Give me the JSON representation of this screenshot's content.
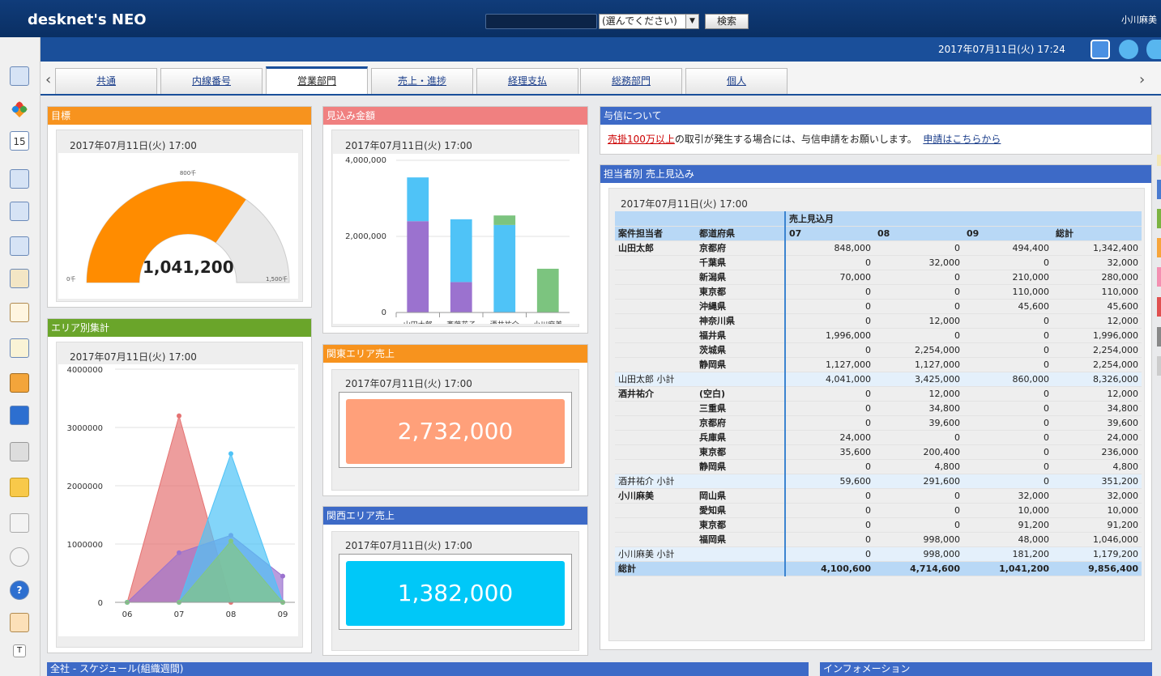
{
  "app": {
    "logo": "desknet's NEO"
  },
  "header": {
    "search_placeholder": "",
    "select_value": "(選んでください)",
    "search_button": "検索",
    "user": "小川麻美",
    "datetime": "2017年07月11日(火) 17:24"
  },
  "tabs": [
    "共通",
    "内線番号",
    "営業部門",
    "売上・進捗",
    "経理支払",
    "総務部門",
    "個人"
  ],
  "active_tab": "営業部門",
  "panels": {
    "goal": {
      "title": "目標",
      "timestamp": "2017年07月11日(火) 17:00",
      "value": "1,041,200",
      "gauge_fraction": 0.694,
      "min_label": "0千",
      "mid_label": "800千",
      "max_label": "1,500千"
    },
    "forecast": {
      "title": "見込み金額",
      "timestamp": "2017年07月11日(火) 17:00"
    },
    "area": {
      "title": "エリア別集計",
      "timestamp": "2017年07月11日(火) 17:00"
    },
    "kanto": {
      "title": "関東エリア売上",
      "timestamp": "2017年07月11日(火) 17:00",
      "value": "2,732,000"
    },
    "kansai": {
      "title": "関西エリア売上",
      "timestamp": "2017年07月11日(火) 17:00",
      "value": "1,382,000"
    },
    "credit": {
      "title": "与信について",
      "link1": "売掛100万以上",
      "text": "の取引が発生する場合には、与信申請をお願いします。",
      "link2": "申請はこちらから"
    },
    "sales": {
      "title": "担当者別 売上見込み",
      "timestamp": "2017年07月11日(火) 17:00",
      "header1": [
        "",
        "",
        "売上見込月",
        "",
        "",
        ""
      ],
      "header2": [
        "案件担当者",
        "都道府県",
        "07",
        "08",
        "09",
        "総計"
      ],
      "rows": [
        [
          "山田太郎",
          "京都府",
          "848,000",
          "0",
          "494,400",
          "1,342,400",
          "n"
        ],
        [
          "",
          "千葉県",
          "0",
          "32,000",
          "0",
          "32,000",
          "n"
        ],
        [
          "",
          "新潟県",
          "70,000",
          "0",
          "210,000",
          "280,000",
          "n"
        ],
        [
          "",
          "東京都",
          "0",
          "0",
          "110,000",
          "110,000",
          "n"
        ],
        [
          "",
          "沖縄県",
          "0",
          "0",
          "45,600",
          "45,600",
          "n"
        ],
        [
          "",
          "神奈川県",
          "0",
          "12,000",
          "0",
          "12,000",
          "n"
        ],
        [
          "",
          "福井県",
          "1,996,000",
          "0",
          "0",
          "1,996,000",
          "n"
        ],
        [
          "",
          "茨城県",
          "0",
          "2,254,000",
          "0",
          "2,254,000",
          "n"
        ],
        [
          "",
          "静岡県",
          "1,127,000",
          "1,127,000",
          "0",
          "2,254,000",
          "n"
        ],
        [
          "山田太郎 小計",
          "",
          "4,041,000",
          "3,425,000",
          "860,000",
          "8,326,000",
          "s"
        ],
        [
          "酒井祐介",
          "(空白)",
          "0",
          "12,000",
          "0",
          "12,000",
          "n"
        ],
        [
          "",
          "三重県",
          "0",
          "34,800",
          "0",
          "34,800",
          "n"
        ],
        [
          "",
          "京都府",
          "0",
          "39,600",
          "0",
          "39,600",
          "n"
        ],
        [
          "",
          "兵庫県",
          "24,000",
          "0",
          "0",
          "24,000",
          "n"
        ],
        [
          "",
          "東京都",
          "35,600",
          "200,400",
          "0",
          "236,000",
          "n"
        ],
        [
          "",
          "静岡県",
          "0",
          "4,800",
          "0",
          "4,800",
          "n"
        ],
        [
          "酒井祐介 小計",
          "",
          "59,600",
          "291,600",
          "0",
          "351,200",
          "s"
        ],
        [
          "小川麻美",
          "岡山県",
          "0",
          "0",
          "32,000",
          "32,000",
          "n"
        ],
        [
          "",
          "愛知県",
          "0",
          "0",
          "10,000",
          "10,000",
          "n"
        ],
        [
          "",
          "東京都",
          "0",
          "0",
          "91,200",
          "91,200",
          "n"
        ],
        [
          "",
          "福岡県",
          "0",
          "998,000",
          "48,000",
          "1,046,000",
          "n"
        ],
        [
          "小川麻美 小計",
          "",
          "0",
          "998,000",
          "181,200",
          "1,179,200",
          "s"
        ],
        [
          "総計",
          "",
          "4,100,600",
          "4,714,600",
          "1,041,200",
          "9,856,400",
          "t"
        ]
      ]
    },
    "schedule": {
      "title": "全社 - スケジュール(組織週間)"
    },
    "info": {
      "title": "インフォメーション"
    }
  },
  "chart_data": [
    {
      "type": "bar",
      "title": "",
      "categories": [
        "山田太郎",
        "斉藤花子",
        "酒井祐介",
        "小川麻美"
      ],
      "ylim": [
        0,
        4000000
      ],
      "yticks": [
        "4,000,000",
        "2,000,000",
        "0"
      ],
      "series": [
        {
          "color": "#9b72cf",
          "values": [
            2400000,
            800000,
            0,
            0
          ]
        },
        {
          "color": "#4fc3f7",
          "values": [
            1150000,
            1650000,
            2300000,
            0
          ]
        },
        {
          "color": "#7cc47f",
          "values": [
            0,
            0,
            250000,
            1150000
          ]
        }
      ]
    },
    {
      "type": "area",
      "title": "",
      "categories": [
        "06",
        "07",
        "08",
        "09"
      ],
      "ylim": [
        0,
        4000000
      ],
      "yticks": [
        "4000000",
        "3000000",
        "2000000",
        "1000000",
        "0"
      ],
      "series": [
        {
          "color": "#e57373",
          "values": [
            0,
            3200000,
            0,
            0
          ]
        },
        {
          "color": "#9b72cf",
          "values": [
            0,
            850000,
            1150000,
            450000
          ]
        },
        {
          "color": "#4fc3f7",
          "values": [
            0,
            0,
            2550000,
            0
          ]
        },
        {
          "color": "#81c784",
          "values": [
            0,
            0,
            1050000,
            0
          ]
        }
      ]
    }
  ]
}
